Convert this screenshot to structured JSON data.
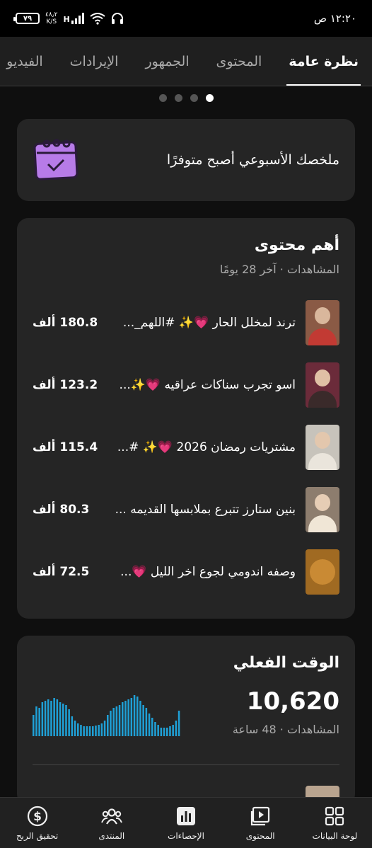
{
  "status_bar": {
    "time": "١٢:٢٠ ص",
    "battery": "٧٩",
    "net_speed": "٤٨٫٢",
    "net_unit": "K/S",
    "network_type": "H"
  },
  "tabs": [
    {
      "label": "نظرة عامة",
      "active": true
    },
    {
      "label": "المحتوى",
      "active": false
    },
    {
      "label": "الجمهور",
      "active": false
    },
    {
      "label": "الإيرادات",
      "active": false
    },
    {
      "label": "الفيديو",
      "active": false
    }
  ],
  "pager": {
    "count": 4,
    "active_index": 0
  },
  "weekly_summary": {
    "text": "ملخصك الأسبوعي أصبح متوفرًا",
    "icon": "calendar-check-icon"
  },
  "top_content": {
    "title": "أهم محتوى",
    "subtitle": "المشاهدات · آخر 28 يومًا",
    "videos": [
      {
        "title": "ترند لمخلل الحار 💗✨ #اللهم_...",
        "views": "180.8 ألف"
      },
      {
        "title": "اسو تجرب سناكات عراقيه 💗✨...",
        "views": "123.2 ألف"
      },
      {
        "title": "مشتريات رمضان 2026 💗✨ #...",
        "views": "115.4 ألف"
      },
      {
        "title": "بنين ستارز تتبرع بملابسها القديمه ...",
        "views": "80.3 ألف"
      },
      {
        "title": "وصفه اندومي لجوع اخر الليل 💗...",
        "views": "72.5 ألف"
      }
    ]
  },
  "realtime": {
    "title": "الوقت الفعلي",
    "views": "10,620",
    "subtitle": "المشاهدات · 48 ساعة",
    "bars": [
      30,
      42,
      40,
      48,
      50,
      52,
      50,
      54,
      52,
      48,
      46,
      44,
      38,
      28,
      22,
      18,
      16,
      14,
      14,
      14,
      14,
      15,
      16,
      18,
      22,
      30,
      36,
      40,
      42,
      44,
      48,
      50,
      52,
      54,
      58,
      56,
      50,
      44,
      40,
      32,
      26,
      20,
      16,
      12,
      12,
      12,
      14,
      16,
      22,
      36
    ],
    "accent_color": "#1fa0d6"
  },
  "bottom_nav": [
    {
      "label": "لوحة البيانات",
      "icon": "dashboard-icon"
    },
    {
      "label": "المحتوى",
      "icon": "content-icon"
    },
    {
      "label": "الإحصاءات",
      "icon": "analytics-icon"
    },
    {
      "label": "المنتدى",
      "icon": "community-icon"
    },
    {
      "label": "تحقيق الربح",
      "icon": "dollar-icon"
    }
  ]
}
